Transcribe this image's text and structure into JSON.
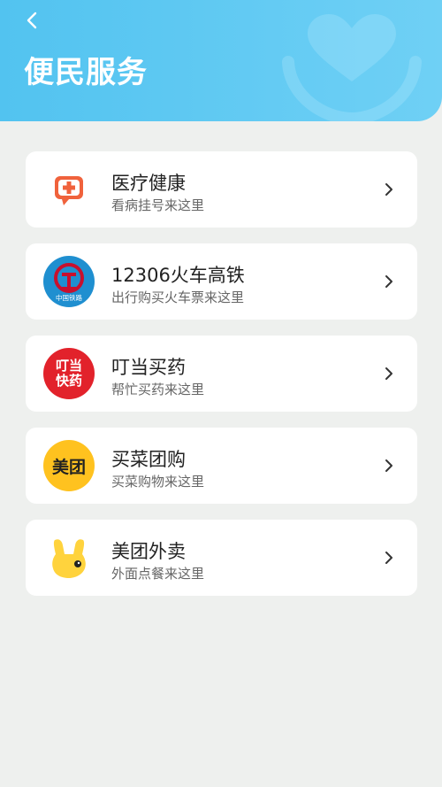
{
  "header": {
    "title": "便民服务",
    "back_icon": "chevron-left-icon",
    "decoration_icon": "heart-hand-icon"
  },
  "services": [
    {
      "title": "医疗健康",
      "subtitle": "看病挂号来这里",
      "icon": "medical-cross-icon",
      "accent": "#f0623c"
    },
    {
      "title": "12306火车高铁",
      "subtitle": "出行购买火车票来这里",
      "icon": "china-railway-icon",
      "logo_text": "中国铁路",
      "accent": "#1f8fd0"
    },
    {
      "title": "叮当买药",
      "subtitle": "帮忙买药来这里",
      "icon": "dingdang-icon",
      "logo_text": "叮当快药",
      "accent": "#e2222b"
    },
    {
      "title": "买菜团购",
      "subtitle": "买菜购物来这里",
      "icon": "meituan-icon",
      "logo_text": "美团",
      "accent": "#ffc21f"
    },
    {
      "title": "美团外卖",
      "subtitle": "外面点餐来这里",
      "icon": "meituan-waimai-kangaroo-icon",
      "accent": "#ffd33d"
    }
  ]
}
